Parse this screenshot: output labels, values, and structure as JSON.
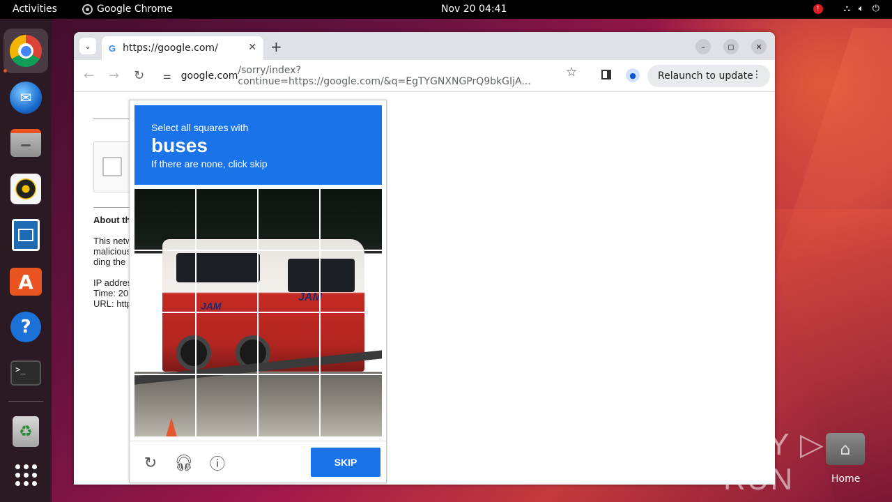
{
  "topbar": {
    "activities": "Activities",
    "app_name": "Google Chrome",
    "clock": "Nov 20  04:41",
    "alert": "!"
  },
  "dock": {
    "items": [
      "chrome",
      "thunderbird",
      "files",
      "rhythmbox",
      "libreoffice-writer",
      "app-center",
      "help",
      "terminal",
      "trash",
      "show-apps"
    ],
    "help_glyph": "?",
    "terminal_glyph": ">_",
    "store_glyph": "A",
    "trash_glyph": "♻"
  },
  "browser": {
    "tab_title": "https://google.com/",
    "favicon": "G",
    "tab_close": "✕",
    "new_tab": "+",
    "url_host": "google.com",
    "url_rest": "/sorry/index?continue=https://google.com/&q=EgTYGNXNGPrQ9bkGIjA...",
    "relaunch_label": "Relaunch to update",
    "relaunch_menu": "⋮",
    "minimize": "–",
    "maximize": "◻",
    "close": "✕"
  },
  "page": {
    "about_heading": "About th",
    "para_lines": [
      "This netw",
      "malicious",
      "ding the"
    ],
    "info_lines": [
      "IP addres",
      "Time: 20",
      "URL: http"
    ]
  },
  "captcha": {
    "line1": "Select all squares with",
    "target": "buses",
    "line3": "If there are none, click skip",
    "skip_label": "SKIP",
    "bus_logo": "JAM",
    "grid_rows": 4,
    "grid_cols": 4
  },
  "desktop": {
    "watermark": "ANY ▷ RUN",
    "home_label": "Home"
  },
  "colors": {
    "accent": "#1a73e8",
    "ubuntu_orange": "#e95420"
  }
}
